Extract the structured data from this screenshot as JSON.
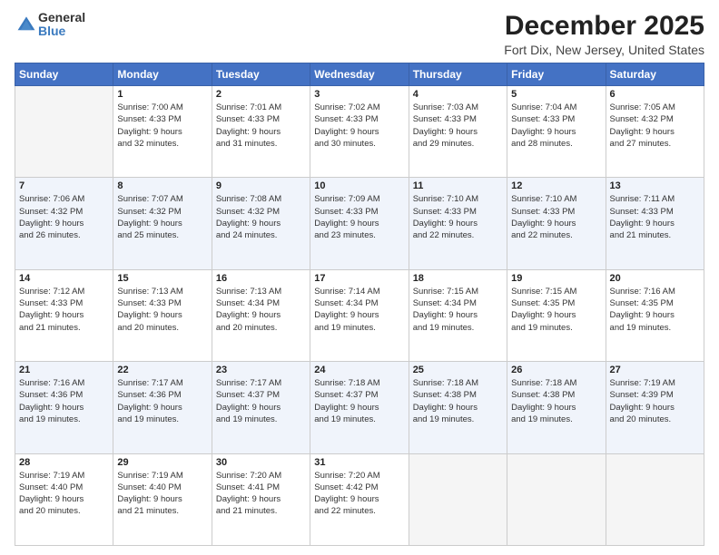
{
  "logo": {
    "general": "General",
    "blue": "Blue"
  },
  "header": {
    "month": "December 2025",
    "location": "Fort Dix, New Jersey, United States"
  },
  "weekdays": [
    "Sunday",
    "Monday",
    "Tuesday",
    "Wednesday",
    "Thursday",
    "Friday",
    "Saturday"
  ],
  "weeks": [
    [
      {
        "day": "",
        "info": ""
      },
      {
        "day": "1",
        "info": "Sunrise: 7:00 AM\nSunset: 4:33 PM\nDaylight: 9 hours\nand 32 minutes."
      },
      {
        "day": "2",
        "info": "Sunrise: 7:01 AM\nSunset: 4:33 PM\nDaylight: 9 hours\nand 31 minutes."
      },
      {
        "day": "3",
        "info": "Sunrise: 7:02 AM\nSunset: 4:33 PM\nDaylight: 9 hours\nand 30 minutes."
      },
      {
        "day": "4",
        "info": "Sunrise: 7:03 AM\nSunset: 4:33 PM\nDaylight: 9 hours\nand 29 minutes."
      },
      {
        "day": "5",
        "info": "Sunrise: 7:04 AM\nSunset: 4:33 PM\nDaylight: 9 hours\nand 28 minutes."
      },
      {
        "day": "6",
        "info": "Sunrise: 7:05 AM\nSunset: 4:32 PM\nDaylight: 9 hours\nand 27 minutes."
      }
    ],
    [
      {
        "day": "7",
        "info": "Sunrise: 7:06 AM\nSunset: 4:32 PM\nDaylight: 9 hours\nand 26 minutes."
      },
      {
        "day": "8",
        "info": "Sunrise: 7:07 AM\nSunset: 4:32 PM\nDaylight: 9 hours\nand 25 minutes."
      },
      {
        "day": "9",
        "info": "Sunrise: 7:08 AM\nSunset: 4:32 PM\nDaylight: 9 hours\nand 24 minutes."
      },
      {
        "day": "10",
        "info": "Sunrise: 7:09 AM\nSunset: 4:33 PM\nDaylight: 9 hours\nand 23 minutes."
      },
      {
        "day": "11",
        "info": "Sunrise: 7:10 AM\nSunset: 4:33 PM\nDaylight: 9 hours\nand 22 minutes."
      },
      {
        "day": "12",
        "info": "Sunrise: 7:10 AM\nSunset: 4:33 PM\nDaylight: 9 hours\nand 22 minutes."
      },
      {
        "day": "13",
        "info": "Sunrise: 7:11 AM\nSunset: 4:33 PM\nDaylight: 9 hours\nand 21 minutes."
      }
    ],
    [
      {
        "day": "14",
        "info": "Sunrise: 7:12 AM\nSunset: 4:33 PM\nDaylight: 9 hours\nand 21 minutes."
      },
      {
        "day": "15",
        "info": "Sunrise: 7:13 AM\nSunset: 4:33 PM\nDaylight: 9 hours\nand 20 minutes."
      },
      {
        "day": "16",
        "info": "Sunrise: 7:13 AM\nSunset: 4:34 PM\nDaylight: 9 hours\nand 20 minutes."
      },
      {
        "day": "17",
        "info": "Sunrise: 7:14 AM\nSunset: 4:34 PM\nDaylight: 9 hours\nand 19 minutes."
      },
      {
        "day": "18",
        "info": "Sunrise: 7:15 AM\nSunset: 4:34 PM\nDaylight: 9 hours\nand 19 minutes."
      },
      {
        "day": "19",
        "info": "Sunrise: 7:15 AM\nSunset: 4:35 PM\nDaylight: 9 hours\nand 19 minutes."
      },
      {
        "day": "20",
        "info": "Sunrise: 7:16 AM\nSunset: 4:35 PM\nDaylight: 9 hours\nand 19 minutes."
      }
    ],
    [
      {
        "day": "21",
        "info": "Sunrise: 7:16 AM\nSunset: 4:36 PM\nDaylight: 9 hours\nand 19 minutes."
      },
      {
        "day": "22",
        "info": "Sunrise: 7:17 AM\nSunset: 4:36 PM\nDaylight: 9 hours\nand 19 minutes."
      },
      {
        "day": "23",
        "info": "Sunrise: 7:17 AM\nSunset: 4:37 PM\nDaylight: 9 hours\nand 19 minutes."
      },
      {
        "day": "24",
        "info": "Sunrise: 7:18 AM\nSunset: 4:37 PM\nDaylight: 9 hours\nand 19 minutes."
      },
      {
        "day": "25",
        "info": "Sunrise: 7:18 AM\nSunset: 4:38 PM\nDaylight: 9 hours\nand 19 minutes."
      },
      {
        "day": "26",
        "info": "Sunrise: 7:18 AM\nSunset: 4:38 PM\nDaylight: 9 hours\nand 19 minutes."
      },
      {
        "day": "27",
        "info": "Sunrise: 7:19 AM\nSunset: 4:39 PM\nDaylight: 9 hours\nand 20 minutes."
      }
    ],
    [
      {
        "day": "28",
        "info": "Sunrise: 7:19 AM\nSunset: 4:40 PM\nDaylight: 9 hours\nand 20 minutes."
      },
      {
        "day": "29",
        "info": "Sunrise: 7:19 AM\nSunset: 4:40 PM\nDaylight: 9 hours\nand 21 minutes."
      },
      {
        "day": "30",
        "info": "Sunrise: 7:20 AM\nSunset: 4:41 PM\nDaylight: 9 hours\nand 21 minutes."
      },
      {
        "day": "31",
        "info": "Sunrise: 7:20 AM\nSunset: 4:42 PM\nDaylight: 9 hours\nand 22 minutes."
      },
      {
        "day": "",
        "info": ""
      },
      {
        "day": "",
        "info": ""
      },
      {
        "day": "",
        "info": ""
      }
    ]
  ]
}
